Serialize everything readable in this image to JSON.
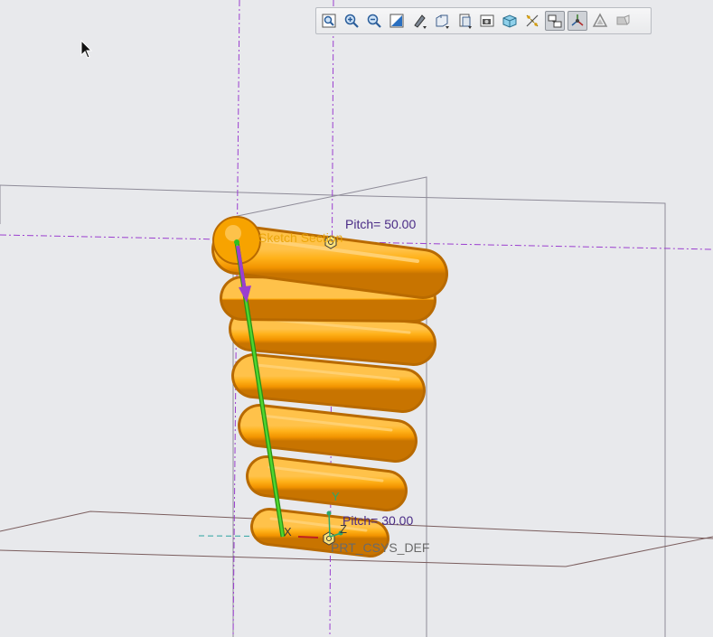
{
  "toolbar": {
    "buttons": [
      {
        "name": "refit-icon",
        "active": false
      },
      {
        "name": "zoom-in-icon",
        "active": false
      },
      {
        "name": "zoom-out-icon",
        "active": false
      },
      {
        "name": "repaint-icon",
        "active": false
      },
      {
        "name": "reorient-icon",
        "active": false
      },
      {
        "name": "saved-orientations-icon",
        "active": false
      },
      {
        "name": "view-manager-icon",
        "active": false
      },
      {
        "name": "perspective-icon",
        "active": false
      },
      {
        "name": "display-style-icon",
        "active": false
      },
      {
        "name": "datum-display-icon",
        "active": false
      },
      {
        "name": "annotation-display-icon",
        "active": true
      },
      {
        "name": "spin-center-icon",
        "active": true
      },
      {
        "name": "appearance-icon",
        "active": false
      },
      {
        "name": "section-icon",
        "active": false
      }
    ]
  },
  "model": {
    "pitch_top": "Pitch= 50.00",
    "pitch_bottom": "Pitch= 30.00",
    "csys_label": "PRT_CSYS_DEF",
    "section_label": "Sketch Section",
    "axis_x": "X",
    "axis_y": "Y",
    "axis_z": "Z"
  },
  "colors": {
    "background": "#e8e9ec",
    "spring": "#f29c00",
    "datum_axis": "#9b3fcf",
    "profile": "#2fbf1f",
    "pitch_text": "#4a2b86"
  }
}
